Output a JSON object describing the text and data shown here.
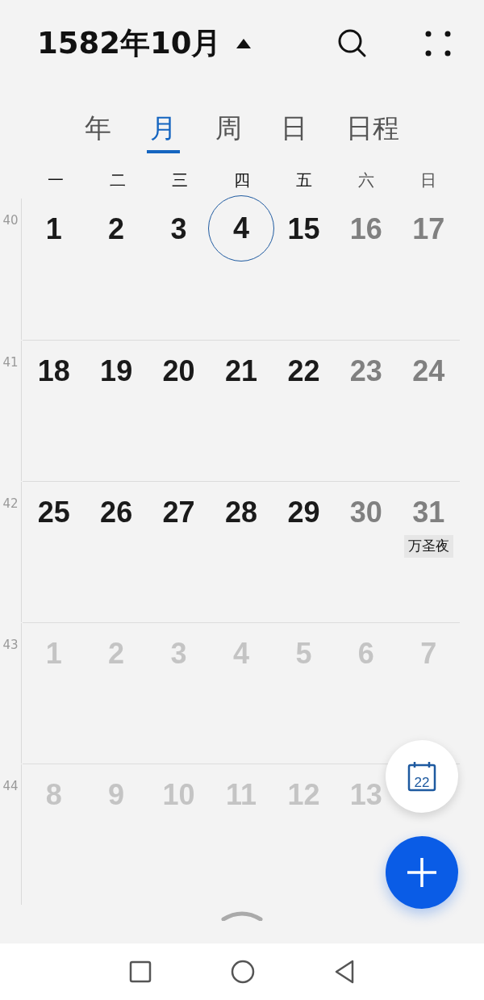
{
  "header": {
    "title": "1582年10月"
  },
  "today_button": {
    "day": "22"
  },
  "tabs": [
    {
      "label": "年",
      "selected": false
    },
    {
      "label": "月",
      "selected": true
    },
    {
      "label": "周",
      "selected": false
    },
    {
      "label": "日",
      "selected": false
    },
    {
      "label": "日程",
      "selected": false
    }
  ],
  "weekdays": [
    {
      "label": "一",
      "weekend": false
    },
    {
      "label": "二",
      "weekend": false
    },
    {
      "label": "三",
      "weekend": false
    },
    {
      "label": "四",
      "weekend": false
    },
    {
      "label": "五",
      "weekend": false
    },
    {
      "label": "六",
      "weekend": true
    },
    {
      "label": "日",
      "weekend": true
    }
  ],
  "weeks": [
    {
      "number": "40",
      "days": [
        {
          "label": "1",
          "kind": "current",
          "selected": false
        },
        {
          "label": "2",
          "kind": "current",
          "selected": false
        },
        {
          "label": "3",
          "kind": "current",
          "selected": false
        },
        {
          "label": "4",
          "kind": "current",
          "selected": true
        },
        {
          "label": "15",
          "kind": "current",
          "selected": false
        },
        {
          "label": "16",
          "kind": "weekend",
          "selected": false
        },
        {
          "label": "17",
          "kind": "weekend",
          "selected": false
        }
      ]
    },
    {
      "number": "41",
      "days": [
        {
          "label": "18",
          "kind": "current",
          "selected": false
        },
        {
          "label": "19",
          "kind": "current",
          "selected": false
        },
        {
          "label": "20",
          "kind": "current",
          "selected": false
        },
        {
          "label": "21",
          "kind": "current",
          "selected": false
        },
        {
          "label": "22",
          "kind": "current",
          "selected": false
        },
        {
          "label": "23",
          "kind": "weekend",
          "selected": false
        },
        {
          "label": "24",
          "kind": "weekend",
          "selected": false
        }
      ]
    },
    {
      "number": "42",
      "days": [
        {
          "label": "25",
          "kind": "current",
          "selected": false
        },
        {
          "label": "26",
          "kind": "current",
          "selected": false
        },
        {
          "label": "27",
          "kind": "current",
          "selected": false
        },
        {
          "label": "28",
          "kind": "current",
          "selected": false
        },
        {
          "label": "29",
          "kind": "current",
          "selected": false
        },
        {
          "label": "30",
          "kind": "weekend",
          "selected": false
        },
        {
          "label": "31",
          "kind": "weekend",
          "selected": false,
          "events": [
            "万圣夜"
          ]
        }
      ]
    },
    {
      "number": "43",
      "days": [
        {
          "label": "1",
          "kind": "other",
          "selected": false
        },
        {
          "label": "2",
          "kind": "other",
          "selected": false
        },
        {
          "label": "3",
          "kind": "other",
          "selected": false
        },
        {
          "label": "4",
          "kind": "other",
          "selected": false
        },
        {
          "label": "5",
          "kind": "other",
          "selected": false
        },
        {
          "label": "6",
          "kind": "other",
          "selected": false
        },
        {
          "label": "7",
          "kind": "other",
          "selected": false
        }
      ]
    },
    {
      "number": "44",
      "days": [
        {
          "label": "8",
          "kind": "other",
          "selected": false
        },
        {
          "label": "9",
          "kind": "other",
          "selected": false
        },
        {
          "label": "10",
          "kind": "other",
          "selected": false
        },
        {
          "label": "11",
          "kind": "other",
          "selected": false
        },
        {
          "label": "12",
          "kind": "other",
          "selected": false
        },
        {
          "label": "13",
          "kind": "other",
          "selected": false
        }
      ]
    }
  ]
}
